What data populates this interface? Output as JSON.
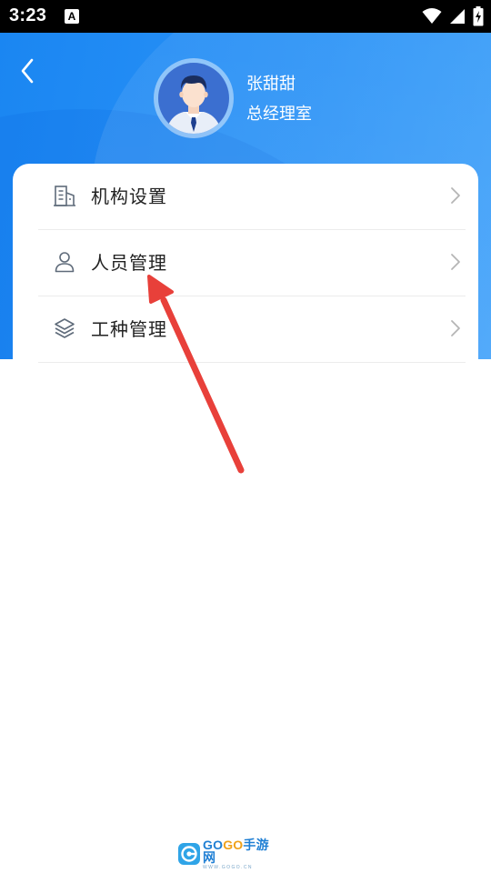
{
  "status_bar": {
    "time": "3:23",
    "notification_icon": "A",
    "icons": [
      "wifi-icon",
      "signal-icon",
      "battery-charging-icon"
    ]
  },
  "header": {
    "back_icon": "chevron-left-icon",
    "user": {
      "name": "张甜甜",
      "department": "总经理室",
      "avatar_icon": "user-avatar-icon"
    }
  },
  "menu": {
    "items": [
      {
        "label": "机构设置",
        "icon": "building-icon"
      },
      {
        "label": "人员管理",
        "icon": "person-icon"
      },
      {
        "label": "工种管理",
        "icon": "layers-icon"
      }
    ],
    "chevron_icon": "chevron-right-icon"
  },
  "annotation": {
    "type": "red-arrow",
    "color": "#e8403a",
    "points_to": "人员管理"
  },
  "watermark": {
    "brand_part1": "GO",
    "brand_part2": "GO",
    "brand_part3": "手游网",
    "url": "WWW.GOGO.CN"
  },
  "colors": {
    "header_blue": "#1a86f2",
    "text_primary": "#222222",
    "icon_gray": "#5f6b7a",
    "chevron_gray": "#b5b5b5"
  }
}
